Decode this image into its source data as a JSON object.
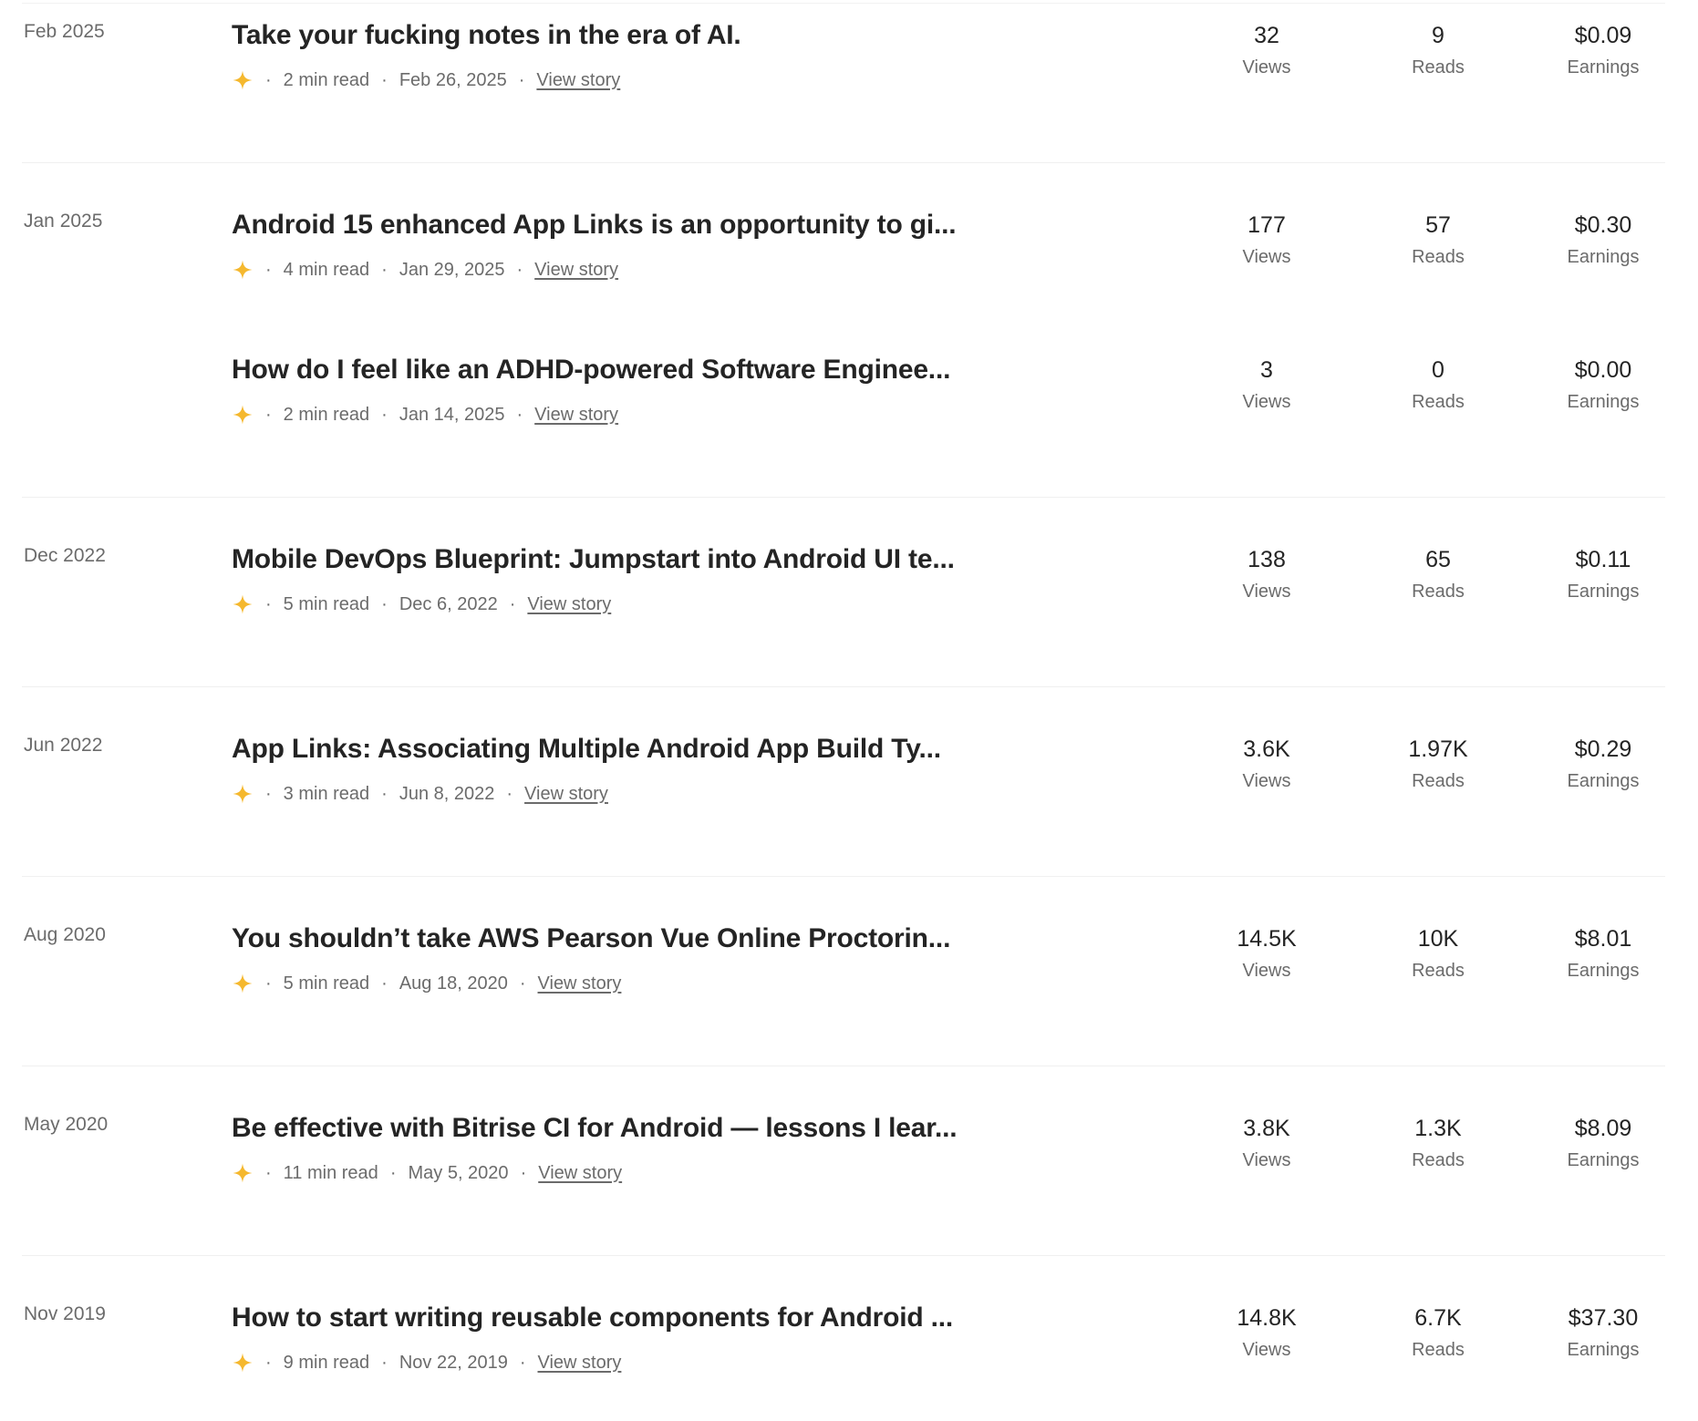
{
  "groups": [
    {
      "month": "Feb 2025",
      "stories": [
        {
          "title": "Take your fucking notes in the era of AI.",
          "read_time": "2 min read",
          "date": "Feb 26, 2025",
          "link": "View story",
          "views": "32",
          "views_label": "Views",
          "reads": "9",
          "reads_label": "Reads",
          "earnings": "$0.09",
          "earnings_label": "Earnings"
        }
      ]
    },
    {
      "month": "Jan 2025",
      "stories": [
        {
          "title": "Android 15 enhanced App Links is an opportunity to gi...",
          "read_time": "4 min read",
          "date": "Jan 29, 2025",
          "link": "View story",
          "views": "177",
          "views_label": "Views",
          "reads": "57",
          "reads_label": "Reads",
          "earnings": "$0.30",
          "earnings_label": "Earnings"
        },
        {
          "title": "How do I feel like an ADHD-powered Software Enginee...",
          "read_time": "2 min read",
          "date": "Jan 14, 2025",
          "link": "View story",
          "views": "3",
          "views_label": "Views",
          "reads": "0",
          "reads_label": "Reads",
          "earnings": "$0.00",
          "earnings_label": "Earnings"
        }
      ]
    },
    {
      "month": "Dec 2022",
      "stories": [
        {
          "title": "Mobile DevOps Blueprint: Jumpstart into Android UI te...",
          "read_time": "5 min read",
          "date": "Dec 6, 2022",
          "link": "View story",
          "views": "138",
          "views_label": "Views",
          "reads": "65",
          "reads_label": "Reads",
          "earnings": "$0.11",
          "earnings_label": "Earnings"
        }
      ]
    },
    {
      "month": "Jun 2022",
      "stories": [
        {
          "title": "App Links: Associating Multiple Android App Build Ty...",
          "read_time": "3 min read",
          "date": "Jun 8, 2022",
          "link": "View story",
          "views": "3.6K",
          "views_label": "Views",
          "reads": "1.97K",
          "reads_label": "Reads",
          "earnings": "$0.29",
          "earnings_label": "Earnings"
        }
      ]
    },
    {
      "month": "Aug 2020",
      "stories": [
        {
          "title": "You shouldn’t take AWS Pearson Vue Online Proctorin...",
          "read_time": "5 min read",
          "date": "Aug 18, 2020",
          "link": "View story",
          "views": "14.5K",
          "views_label": "Views",
          "reads": "10K",
          "reads_label": "Reads",
          "earnings": "$8.01",
          "earnings_label": "Earnings"
        }
      ]
    },
    {
      "month": "May 2020",
      "stories": [
        {
          "title": "Be effective with Bitrise CI for Android — lessons I lear...",
          "read_time": "11 min read",
          "date": "May 5, 2020",
          "link": "View story",
          "views": "3.8K",
          "views_label": "Views",
          "reads": "1.3K",
          "reads_label": "Reads",
          "earnings": "$8.09",
          "earnings_label": "Earnings"
        }
      ]
    },
    {
      "month": "Nov 2019",
      "stories": [
        {
          "title": "How to start writing reusable components for Android ...",
          "read_time": "9 min read",
          "date": "Nov 22, 2019",
          "link": "View story",
          "views": "14.8K",
          "views_label": "Views",
          "reads": "6.7K",
          "reads_label": "Reads",
          "earnings": "$37.30",
          "earnings_label": "Earnings"
        }
      ]
    }
  ],
  "colors": {
    "title": "#242424",
    "muted": "#6b6b6b",
    "star": "#f5b82e",
    "divider": "#f0f0f0"
  },
  "icons": {
    "member_story": "sparkle-star-icon"
  }
}
